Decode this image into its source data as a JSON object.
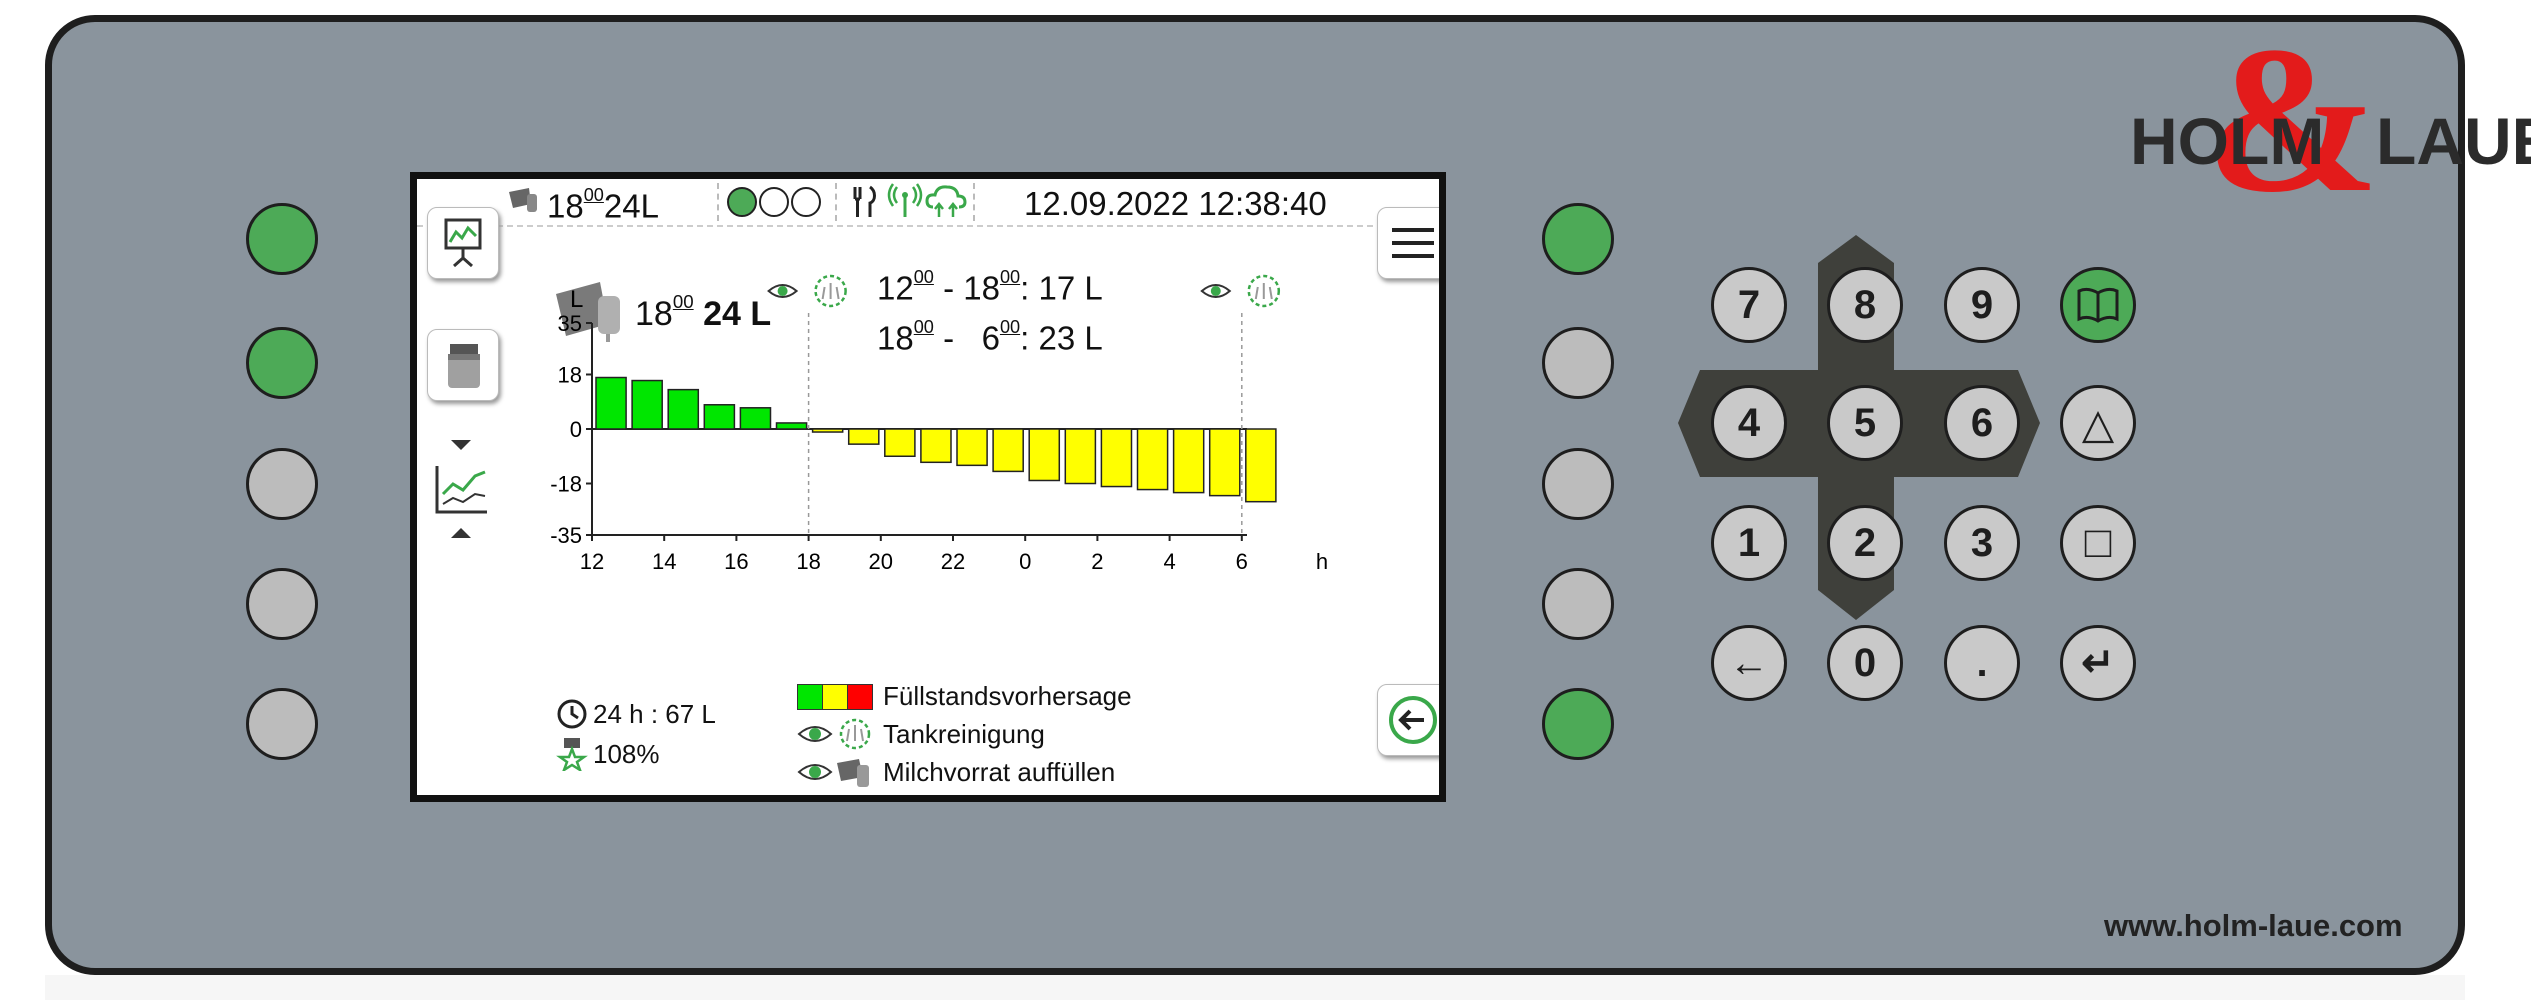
{
  "brand": {
    "ampersand": "&",
    "name_left": "HOLM",
    "name_right": "LAUE",
    "website": "www.holm-laue.com"
  },
  "top_bar": {
    "next_time_h": "18",
    "next_time_m": "00",
    "next_amount": "24L",
    "datetime": "12.09.2022 12:38:40"
  },
  "forecast": {
    "main_time_h": "18",
    "main_time_m": "00",
    "main_amount": "24 L",
    "period1": {
      "from_h": "12",
      "from_m": "00",
      "to_h": "18",
      "to_m": "00",
      "amount": ": 17 L"
    },
    "period2": {
      "from_h": "18",
      "from_m": "00",
      "to_h": "6",
      "to_m": "00",
      "amount": ": 23 L"
    }
  },
  "stats": {
    "daily": "24 h : 67 L",
    "percent": "108%"
  },
  "legend": {
    "fill_forecast": "Füllstandsvorhersage",
    "tank_cleaning": "Tankreinigung",
    "refill_milk": "Milchvorrat auffüllen"
  },
  "colors": {
    "green": "#00e600",
    "yellow": "#ffff00",
    "red": "#ff0000",
    "led_green": "#4daa57",
    "led_gray": "#bcbcbc"
  },
  "icons": [
    "presentation-icon",
    "tank-icon",
    "chart-trend-icon",
    "menu-icon",
    "back-arrow-icon",
    "milk-can-icon",
    "signal-icon",
    "cloud-icon",
    "cutlery-icon",
    "eye-icon",
    "cleaning-icon",
    "clock-icon",
    "star-icon",
    "book-icon"
  ],
  "chart_data": {
    "type": "bar",
    "ylabel": "L",
    "xlabel": "h",
    "ylim": [
      -35,
      35
    ],
    "yticks": [
      "35",
      "18",
      "0",
      "-18",
      "-35"
    ],
    "xticks": [
      "12",
      "14",
      "16",
      "18",
      "20",
      "22",
      "0",
      "2",
      "4",
      "6",
      "h"
    ],
    "categories": [
      "12",
      "13",
      "14",
      "15",
      "16",
      "17",
      "18",
      "19",
      "20",
      "21",
      "22",
      "23",
      "0",
      "1",
      "2",
      "3",
      "4",
      "5",
      "6"
    ],
    "values": [
      17,
      16,
      13,
      8,
      7,
      2,
      -1,
      -5,
      -9,
      -11,
      -12,
      -14,
      -17,
      -18,
      -19,
      -20,
      -21,
      -22,
      -24
    ],
    "grid": false
  },
  "keypad": {
    "k7": "7",
    "k8": "8",
    "k9": "9",
    "k4": "4",
    "k5": "5",
    "k6": "6",
    "k1": "1",
    "k2": "2",
    "k3": "3",
    "k0": "0",
    "kdot": ".",
    "back": "←",
    "enter": "↵",
    "triangle": "△",
    "square": "□"
  }
}
